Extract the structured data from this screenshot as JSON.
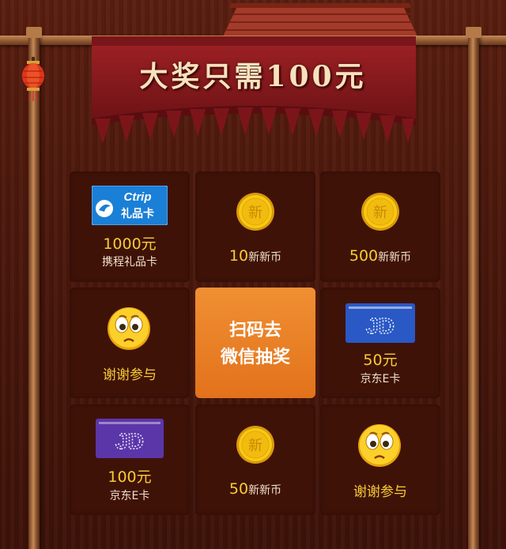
{
  "banner": {
    "title": "大奖只需100元"
  },
  "icons": {
    "coin": "coin-icon",
    "face": "sad-face-icon",
    "card": "gift-card-icon",
    "lantern": "lantern-icon"
  },
  "grid": {
    "ctrip_card": {
      "brand": "Ctrip",
      "badge": "礼品卡",
      "amount": "1000元",
      "name": "携程礼品卡"
    },
    "coin_10": {
      "coin_glyph": "新",
      "amount": "10",
      "unit": "新新币"
    },
    "coin_500": {
      "coin_glyph": "新",
      "amount": "500",
      "unit": "新新币"
    },
    "thanks_1": {
      "label": "谢谢参与"
    },
    "center": {
      "line1": "扫码去",
      "line2": "微信抽奖"
    },
    "jd_50": {
      "logo": "JD",
      "amount": "50元",
      "name": "京东E卡"
    },
    "jd_100": {
      "logo": "JD",
      "amount": "100元",
      "name": "京东E卡"
    },
    "coin_50": {
      "coin_glyph": "新",
      "amount": "50",
      "unit": "新新币"
    },
    "thanks_2": {
      "label": "谢谢参与"
    }
  },
  "colors": {
    "accent": "#f6cd35",
    "center": "#ea7c24",
    "banner": "#8a1a1d"
  }
}
